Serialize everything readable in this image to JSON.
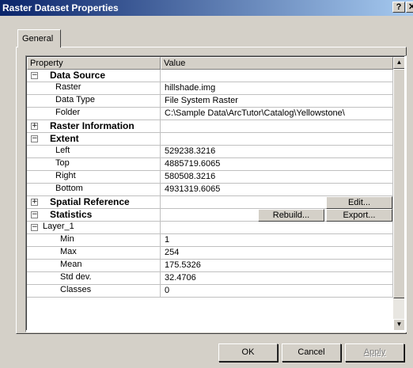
{
  "window": {
    "title": "Raster Dataset Properties",
    "help_label": "?",
    "close_label": "✕"
  },
  "tabs": {
    "general": "General"
  },
  "table": {
    "col_property": "Property",
    "col_value": "Value",
    "rows": [
      {
        "label": "Data Source",
        "value": "",
        "group": true,
        "expander": "⊟"
      },
      {
        "label": "Raster",
        "value": "hillshade.img"
      },
      {
        "label": "Data Type",
        "value": "File System Raster"
      },
      {
        "label": "Folder",
        "value": "C:\\Sample Data\\ArcTutor\\Catalog\\Yellowstone\\"
      },
      {
        "label": "Raster Information",
        "value": "",
        "group": true,
        "expander": "⊞"
      },
      {
        "label": "Extent",
        "value": "",
        "group": true,
        "expander": "⊟"
      },
      {
        "label": "Left",
        "value": "529238.3216"
      },
      {
        "label": "Top",
        "value": "4885719.6065"
      },
      {
        "label": "Right",
        "value": "580508.3216"
      },
      {
        "label": "Bottom",
        "value": "4931319.6065"
      },
      {
        "label": "Spatial Reference",
        "value": "",
        "group": true,
        "expander": "⊞",
        "buttons": [
          "Edit..."
        ]
      },
      {
        "label": "Statistics",
        "value": "",
        "group": true,
        "expander": "⊟",
        "buttons": [
          "Rebuild...",
          "Export..."
        ]
      },
      {
        "label": "Layer_1",
        "value": "",
        "subgroup": true,
        "expander": "⊟"
      },
      {
        "label": "Min",
        "value": "1",
        "deep": true
      },
      {
        "label": "Max",
        "value": "254",
        "deep": true
      },
      {
        "label": "Mean",
        "value": "175.5326",
        "deep": true
      },
      {
        "label": "Std dev.",
        "value": "32.4706",
        "deep": true
      },
      {
        "label": "Classes",
        "value": "0",
        "deep": true
      }
    ]
  },
  "buttons": {
    "ok": "OK",
    "cancel": "Cancel",
    "apply": "Apply"
  }
}
